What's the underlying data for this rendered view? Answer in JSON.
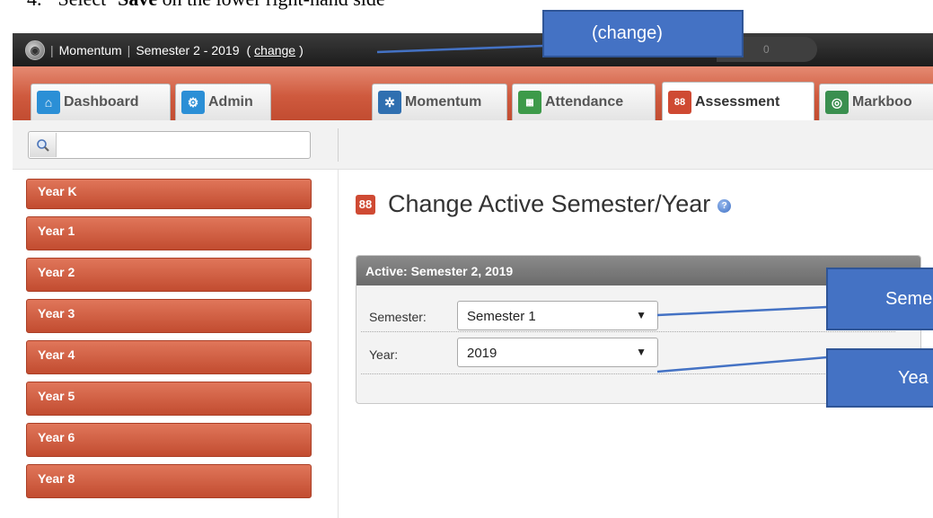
{
  "doc": {
    "step_number": "4.",
    "text_before": "Select ",
    "text_bold": "‘Save",
    "text_after": " on the lower right-hand side"
  },
  "topbar": {
    "app_name": "Momentum",
    "semester_label": "Semester 2 - 2019",
    "change_link": "change",
    "paren_open": "(",
    "paren_close": ")",
    "counter": "0"
  },
  "tabs": [
    {
      "label": "Dashboard",
      "icon": "home-icon"
    },
    {
      "label": "Admin",
      "icon": "gears-icon"
    },
    {
      "label": "Momentum",
      "icon": "gear-icon"
    },
    {
      "label": "Attendance",
      "icon": "attendance-icon"
    },
    {
      "label": "Assessment",
      "icon": "assessment-icon",
      "active": true
    },
    {
      "label": "Markboo",
      "icon": "markbook-icon"
    }
  ],
  "search": {
    "placeholder": "",
    "icon": "search-icon"
  },
  "sidebar": {
    "items": [
      {
        "label": "Year K"
      },
      {
        "label": "Year 1"
      },
      {
        "label": "Year 2"
      },
      {
        "label": "Year 3"
      },
      {
        "label": "Year 4"
      },
      {
        "label": "Year 5"
      },
      {
        "label": "Year 6"
      },
      {
        "label": "Year 8"
      }
    ]
  },
  "main": {
    "title": "Change Active Semester/Year",
    "panel_title": "Active: Semester 2, 2019",
    "semester_label": "Semester:",
    "semester_value": "Semester 1",
    "year_label": "Year:",
    "year_value": "2019"
  },
  "callouts": {
    "change": "(change)",
    "semester": "Seme",
    "year": "Yea"
  },
  "colors": {
    "tab_bar": "#cf5a3e",
    "sidebar_item": "#c9553a",
    "callout": "#4472c4",
    "topbar": "#2a2a2a"
  }
}
